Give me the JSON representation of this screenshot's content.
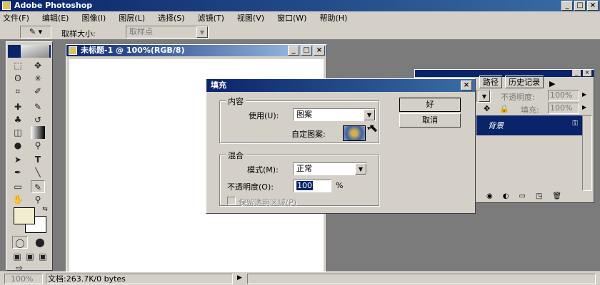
{
  "app": {
    "title": "Adobe Photoshop"
  },
  "menu": [
    "文件(F)",
    "编辑(E)",
    "图像(I)",
    "图层(L)",
    "选择(S)",
    "滤镜(T)",
    "视图(V)",
    "窗口(W)",
    "帮助(H)"
  ],
  "options": {
    "sample_label": "取样大小:",
    "sample_value": "取样点"
  },
  "document": {
    "title": "未标题-1 @ 100%(RGB/8)"
  },
  "layers_panel": {
    "tabs": [
      "路径",
      "历史记录"
    ],
    "opacity_label": "不透明度:",
    "opacity_value": "100%",
    "fill_label": "填充:",
    "fill_value": "100%",
    "layer_name": "背景"
  },
  "dialog": {
    "title": "填充",
    "contents_group": "内容",
    "use_label": "使用(U):",
    "use_value": "图案",
    "custom_pattern_label": "自定图案:",
    "blend_group": "混合",
    "mode_label": "模式(M):",
    "mode_value": "正常",
    "opacity_label": "不透明度(O):",
    "opacity_value": "100",
    "opacity_unit": "%",
    "preserve_label": "保留透明区域(P)",
    "ok_label": "好",
    "cancel_label": "取消"
  },
  "status": {
    "zoom": "100%",
    "doc_info": "文档:263.7K/0 bytes"
  }
}
